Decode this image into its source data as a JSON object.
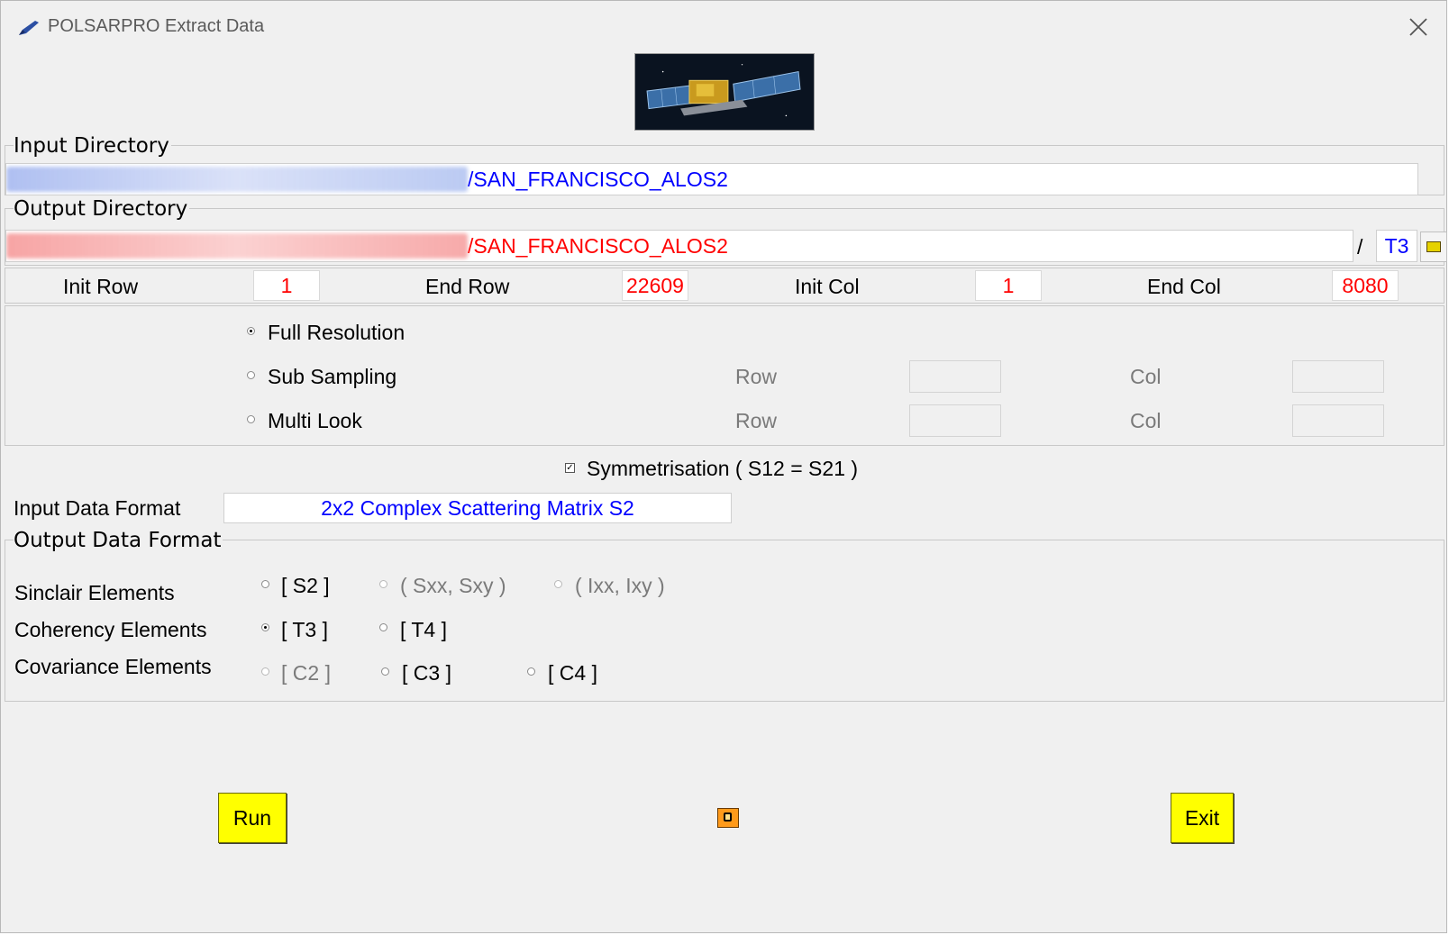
{
  "window": {
    "title": "POLSARPRO Extract Data"
  },
  "input_directory": {
    "label": "Input Directory",
    "path_suffix": "/SAN_FRANCISCO_ALOS2"
  },
  "output_directory": {
    "label": "Output Directory",
    "path_suffix": "/SAN_FRANCISCO_ALOS2",
    "separator": "/",
    "subdir": "T3"
  },
  "row_col": {
    "init_row_label": "Init Row",
    "init_row": "1",
    "end_row_label": "End Row",
    "end_row": "22609",
    "init_col_label": "Init Col",
    "init_col": "1",
    "end_col_label": "End Col",
    "end_col": "8080"
  },
  "sampling": {
    "full_resolution": "Full Resolution",
    "sub_sampling": "Sub Sampling",
    "multi_look": "Multi Look",
    "row_label": "Row",
    "col_label": "Col",
    "selected": "Full Resolution"
  },
  "symmetrisation": {
    "label": "Symmetrisation ( S12 = S21 )",
    "checked": true
  },
  "input_format": {
    "label": "Input Data Format",
    "value": "2x2 Complex Scattering Matrix S2"
  },
  "output_format": {
    "label": "Output Data Format",
    "sinclair_label": "Sinclair Elements",
    "coherency_label": "Coherency Elements",
    "covariance_label": "Covariance Elements",
    "opt_s2": "[ S2 ]",
    "opt_sxx": "( Sxx, Sxy )",
    "opt_ixx": "( Ixx, Ixy )",
    "opt_t3": "[ T3 ]",
    "opt_t4": "[ T4 ]",
    "opt_c2": "[ C2 ]",
    "opt_c3": "[ C3 ]",
    "opt_c4": "[ C4 ]",
    "selected": "[ T3 ]"
  },
  "buttons": {
    "run": "Run",
    "exit": "Exit"
  },
  "colors": {
    "path_blue": "#0000ff",
    "path_red": "#ff0000",
    "button_yellow": "#ffff00",
    "window_bg": "#f0f0f0"
  },
  "icons": [
    "pen-icon",
    "close-icon",
    "folder-icon",
    "help-icon",
    "satellite-image"
  ]
}
